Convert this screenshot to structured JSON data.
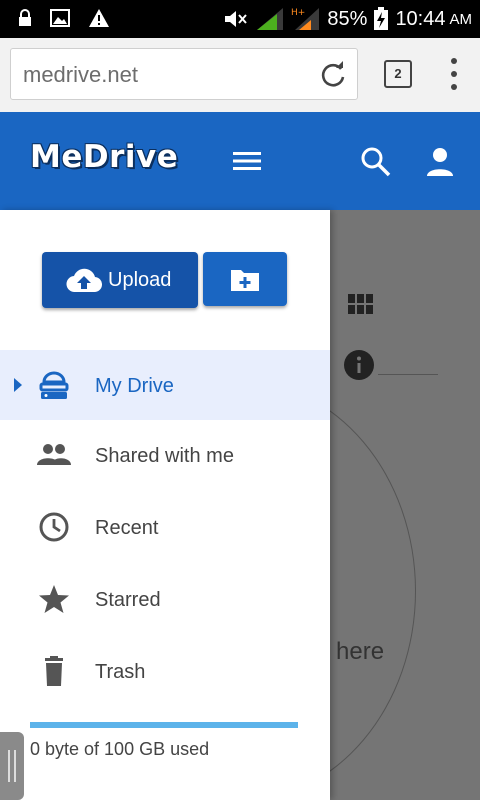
{
  "status_bar": {
    "battery": "85%",
    "time": "10:44",
    "ampm": "AM",
    "network": "H+"
  },
  "browser": {
    "url": "medrive.net",
    "tab_count": "2"
  },
  "header": {
    "logo": "MeDrive",
    "brand_color": "#1a66c2"
  },
  "drawer": {
    "upload_label": "Upload",
    "nav": [
      {
        "label": "My Drive",
        "icon": "drive-icon",
        "active": true
      },
      {
        "label": "Shared with me",
        "icon": "people-icon"
      },
      {
        "label": "Recent",
        "icon": "clock-icon"
      },
      {
        "label": "Starred",
        "icon": "star-icon"
      },
      {
        "label": "Trash",
        "icon": "trash-icon"
      }
    ],
    "storage_text": "0 byte of 100 GB used",
    "storage_used_fraction": 0
  },
  "background": {
    "partial_text": "here"
  }
}
